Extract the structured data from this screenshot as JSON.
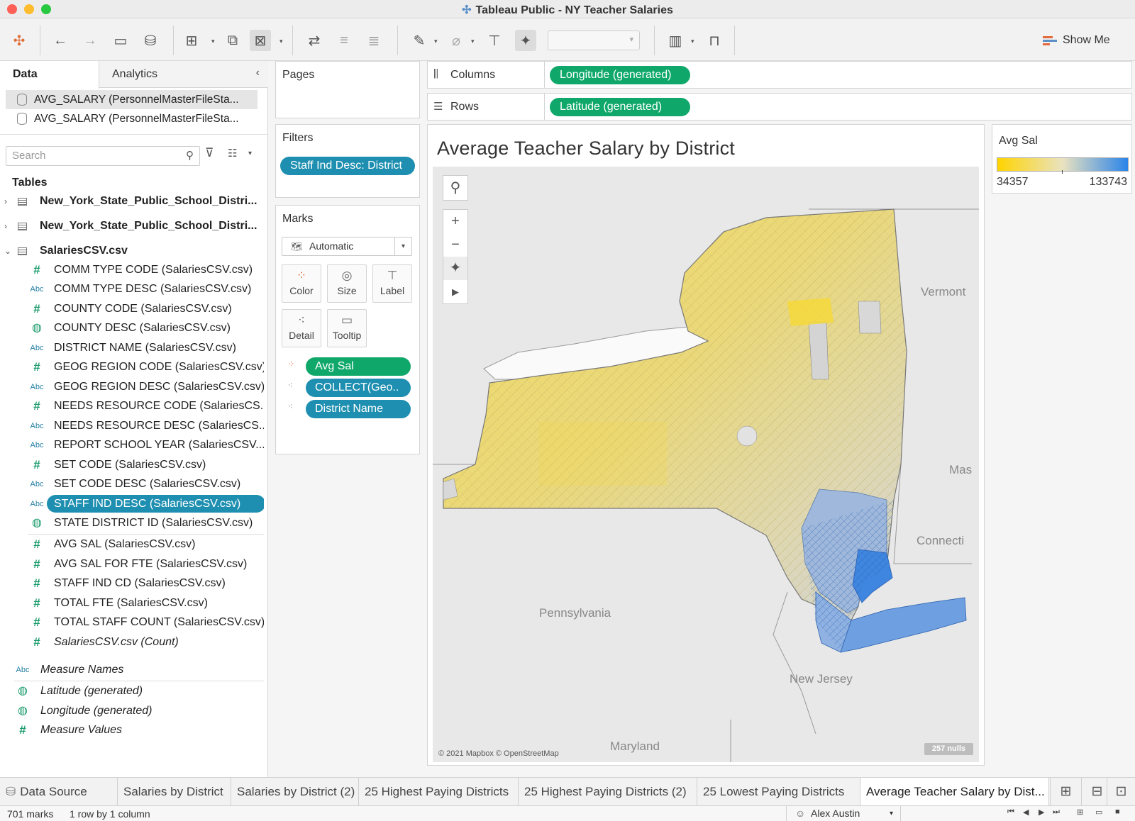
{
  "window": {
    "title": "Tableau Public - NY Teacher Salaries"
  },
  "toolbar": {
    "show_me": "Show Me"
  },
  "data_pane": {
    "tabs": [
      "Data",
      "Analytics"
    ],
    "datasources": [
      "AVG_SALARY (PersonnelMasterFileSta...",
      "AVG_SALARY (PersonnelMasterFileSta..."
    ],
    "search_placeholder": "Search",
    "tables_heading": "Tables",
    "tables": [
      "New_York_State_Public_School_Distri...",
      "New_York_State_Public_School_Distri...",
      "SalariesCSV.csv"
    ],
    "dimensions": [
      {
        "type": "#",
        "name": "COMM TYPE CODE (SalariesCSV.csv)"
      },
      {
        "type": "Abc",
        "name": "COMM TYPE DESC (SalariesCSV.csv)"
      },
      {
        "type": "#",
        "name": "COUNTY CODE (SalariesCSV.csv)"
      },
      {
        "type": "geo",
        "name": "COUNTY DESC (SalariesCSV.csv)"
      },
      {
        "type": "Abc",
        "name": "DISTRICT NAME (SalariesCSV.csv)"
      },
      {
        "type": "#",
        "name": "GEOG REGION CODE (SalariesCSV.csv)"
      },
      {
        "type": "Abc",
        "name": "GEOG REGION DESC (SalariesCSV.csv)"
      },
      {
        "type": "#",
        "name": "NEEDS RESOURCE CODE (SalariesCS..."
      },
      {
        "type": "Abc",
        "name": "NEEDS RESOURCE DESC (SalariesCS..."
      },
      {
        "type": "Abc",
        "name": "REPORT SCHOOL YEAR (SalariesCSV...."
      },
      {
        "type": "#",
        "name": "SET CODE (SalariesCSV.csv)"
      },
      {
        "type": "Abc",
        "name": "SET CODE DESC (SalariesCSV.csv)"
      },
      {
        "type": "Abc",
        "name": "STAFF IND DESC (SalariesCSV.csv)"
      },
      {
        "type": "geo",
        "name": "STATE DISTRICT ID (SalariesCSV.csv)"
      }
    ],
    "measures": [
      {
        "type": "#",
        "name": "AVG SAL (SalariesCSV.csv)"
      },
      {
        "type": "#",
        "name": "AVG SAL FOR FTE (SalariesCSV.csv)"
      },
      {
        "type": "#",
        "name": "STAFF IND CD (SalariesCSV.csv)"
      },
      {
        "type": "#",
        "name": "TOTAL FTE (SalariesCSV.csv)"
      },
      {
        "type": "#",
        "name": "TOTAL STAFF COUNT (SalariesCSV.csv)"
      },
      {
        "type": "#",
        "name": "SalariesCSV.csv (Count)"
      }
    ],
    "extra_fields": [
      {
        "type": "Abc",
        "name": "Measure Names"
      },
      {
        "type": "geo",
        "name": "Latitude (generated)"
      },
      {
        "type": "geo",
        "name": "Longitude (generated)"
      },
      {
        "type": "#",
        "name": "Measure Values"
      }
    ]
  },
  "cards": {
    "pages": "Pages",
    "filters": "Filters",
    "filter_pill": "Staff Ind Desc: District",
    "marks": "Marks",
    "mark_type": "Automatic",
    "mark_buttons": [
      "Color",
      "Size",
      "Label",
      "Detail",
      "Tooltip"
    ],
    "mark_pills": [
      "Avg Sal",
      "COLLECT(Geo..",
      "District Name"
    ]
  },
  "shelves": {
    "columns_label": "Columns",
    "columns_pill": "Longitude (generated)",
    "rows_label": "Rows",
    "rows_pill": "Latitude (generated)"
  },
  "view": {
    "title": "Average Teacher Salary by District",
    "map_labels": [
      "Vermont",
      "Mas",
      "Connecti",
      "Pennsylvania",
      "New Jersey",
      "Maryland"
    ],
    "attribution": "© 2021 Mapbox © OpenStreetMap",
    "nulls_badge": "257 nulls"
  },
  "legend": {
    "title": "Avg Sal",
    "min": "34357",
    "max": "133743",
    "colors": [
      "#ffd400",
      "#e9e2c0",
      "#2b84e9"
    ]
  },
  "sheet_tabs": [
    "Data Source",
    "Salaries by District",
    "Salaries by District (2)",
    "25 Highest Paying Districts",
    "25 Highest Paying Districts (2)",
    "25 Lowest Paying Districts",
    "Average Teacher Salary by Dist..."
  ],
  "status": {
    "marks": "701 marks",
    "dims": "1 row by 1 column",
    "user": "Alex Austin"
  }
}
